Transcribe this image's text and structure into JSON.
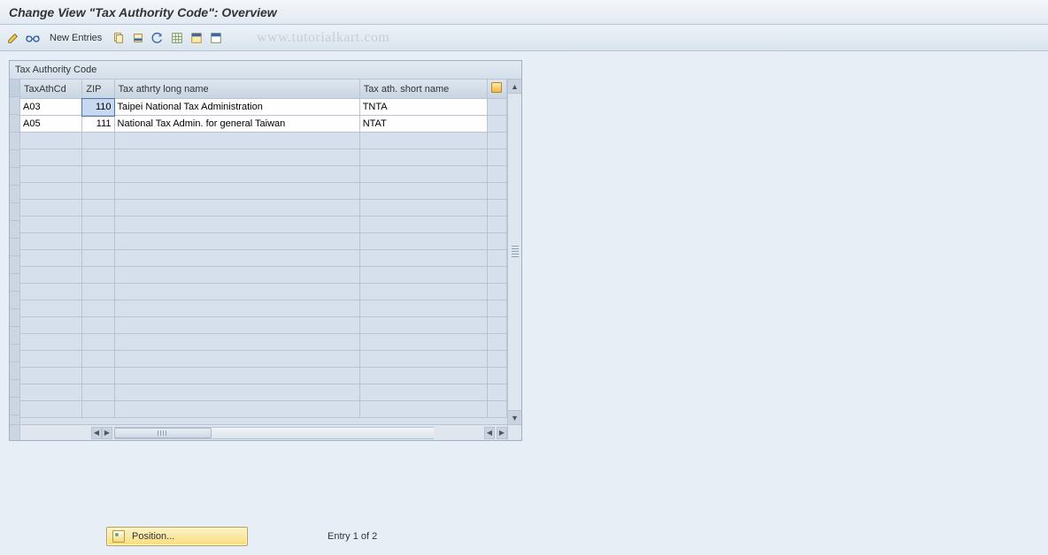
{
  "title": "Change View \"Tax Authority Code\": Overview",
  "toolbar": {
    "new_entries": "New Entries"
  },
  "watermark": "www.tutorialkart.com",
  "panel": {
    "title": "Tax Authority Code",
    "columns": {
      "code": "TaxAthCd",
      "zip": "ZIP",
      "long": "Tax athrty long name",
      "short": "Tax ath. short name"
    },
    "rows": [
      {
        "code": "A03",
        "zip": "110",
        "long": "Taipei National Tax Administration",
        "short": "TNTA",
        "zip_selected": true
      },
      {
        "code": "A05",
        "zip": "111",
        "long": "National Tax Admin. for general Taiwan",
        "short": "NTAT",
        "zip_selected": false
      }
    ],
    "empty_row_count": 17
  },
  "footer": {
    "position_label": "Position...",
    "entry_status": "Entry 1 of 2"
  }
}
